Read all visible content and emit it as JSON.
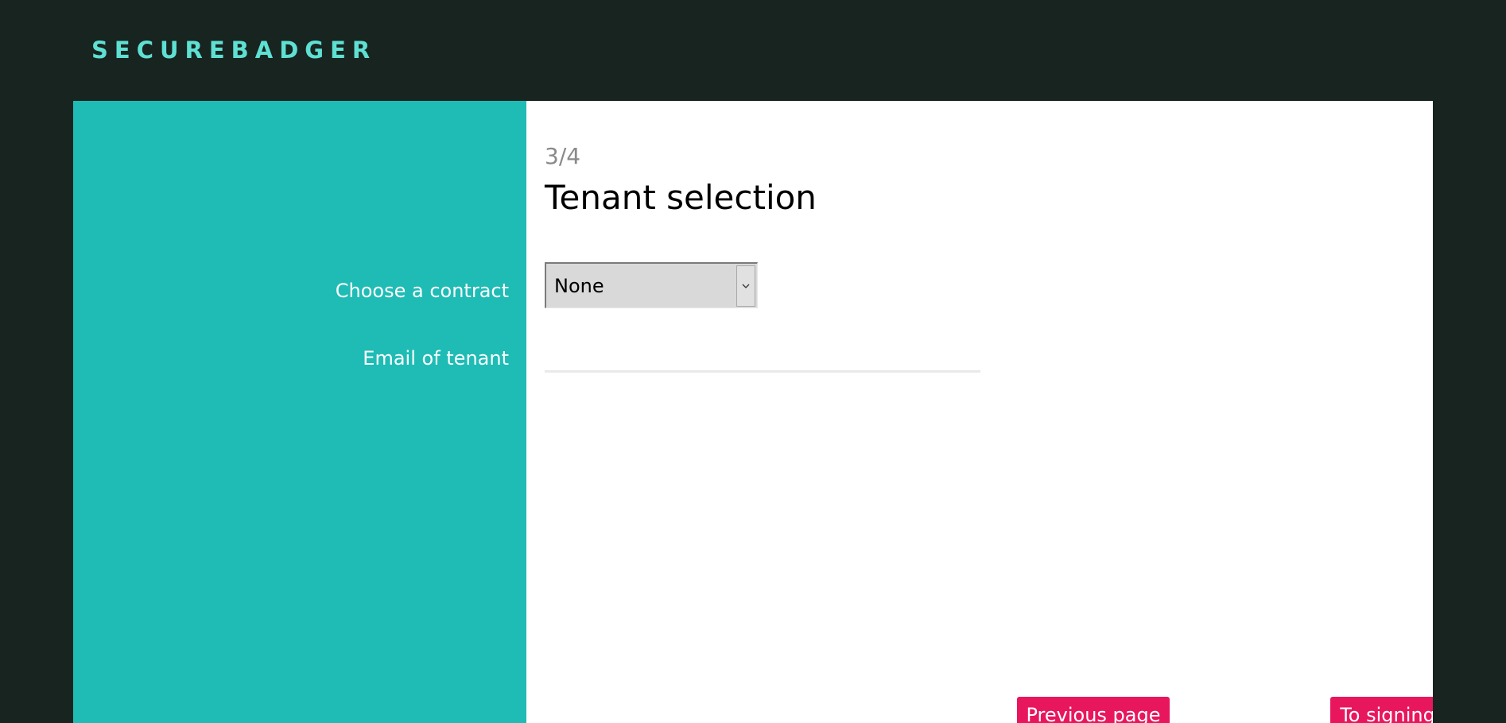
{
  "header": {
    "brand": "SECUREBADGER"
  },
  "sidebar": {
    "contract_label": "Choose a contract",
    "email_label": "Email of tenant"
  },
  "main": {
    "step": "3/4",
    "title": "Tenant selection",
    "contract_select": {
      "selected": "None"
    },
    "email_input": {
      "value": "",
      "placeholder": ""
    },
    "buttons": {
      "previous": "Previous page",
      "next": "To signing"
    }
  },
  "colors": {
    "background": "#172420",
    "brand": "#5ee0d2",
    "sidebar": "#1ebcb5",
    "accent_button": "#e8175d"
  },
  "icons": {
    "select_arrow": "chevron-down-icon"
  }
}
